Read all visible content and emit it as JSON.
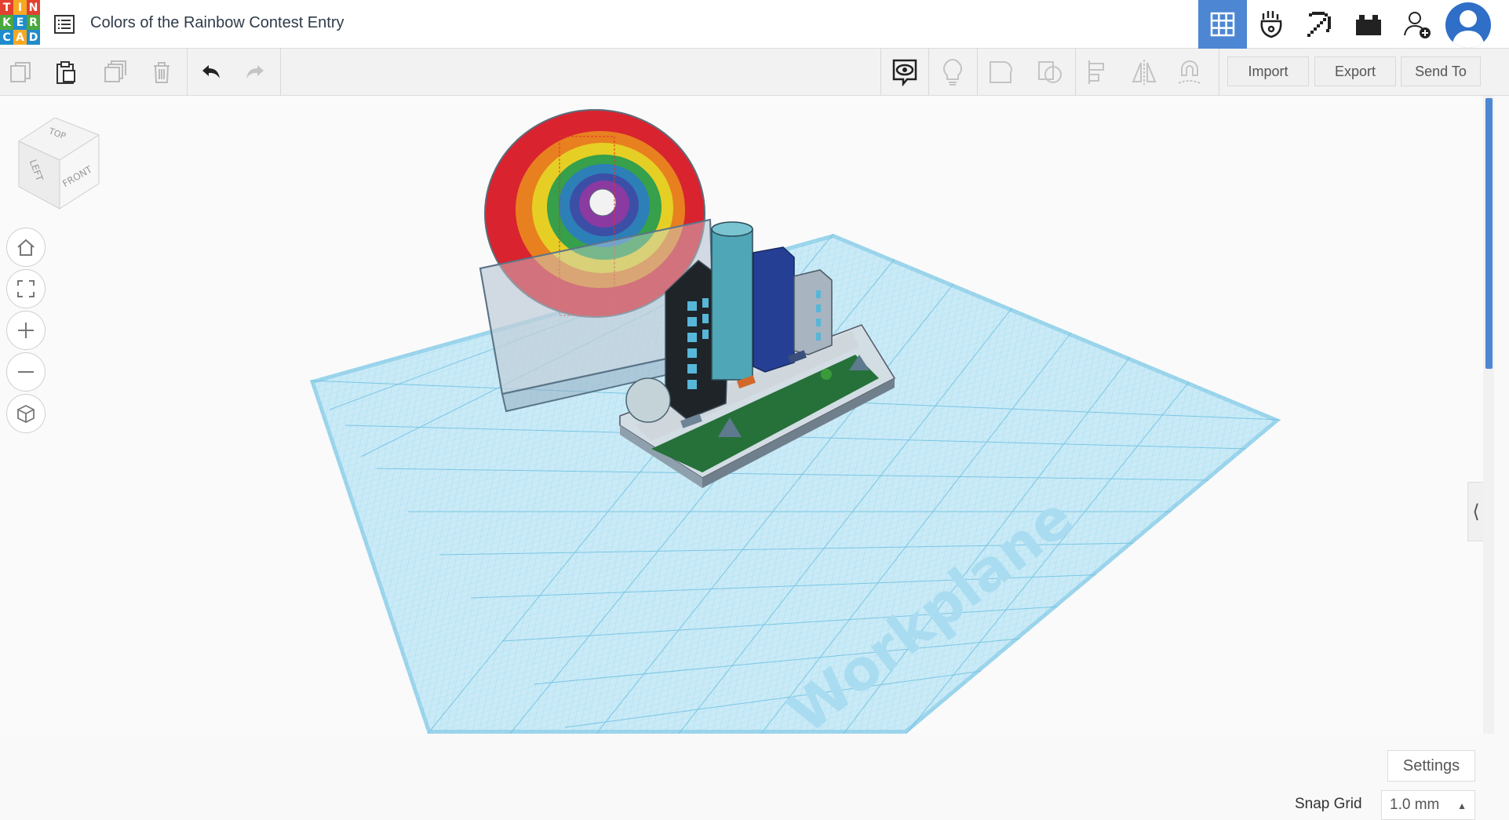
{
  "app": {
    "logo_letters": [
      "T",
      "I",
      "N",
      "K",
      "E",
      "R",
      "C",
      "A",
      "D"
    ],
    "title": "Colors of the Rainbow Contest Entry"
  },
  "toolbar": {
    "import_label": "Import",
    "export_label": "Export",
    "send_to_label": "Send To"
  },
  "viewcube": {
    "top": "TOP",
    "left": "LEFT",
    "front": "FRONT"
  },
  "workplane": {
    "label": "Workplane"
  },
  "bottom": {
    "settings_label": "Settings",
    "snap_grid_label": "Snap Grid",
    "snap_grid_value": "1.0 mm"
  },
  "colors": {
    "accent": "#4d87d3",
    "grid": "#8fd3ec"
  }
}
